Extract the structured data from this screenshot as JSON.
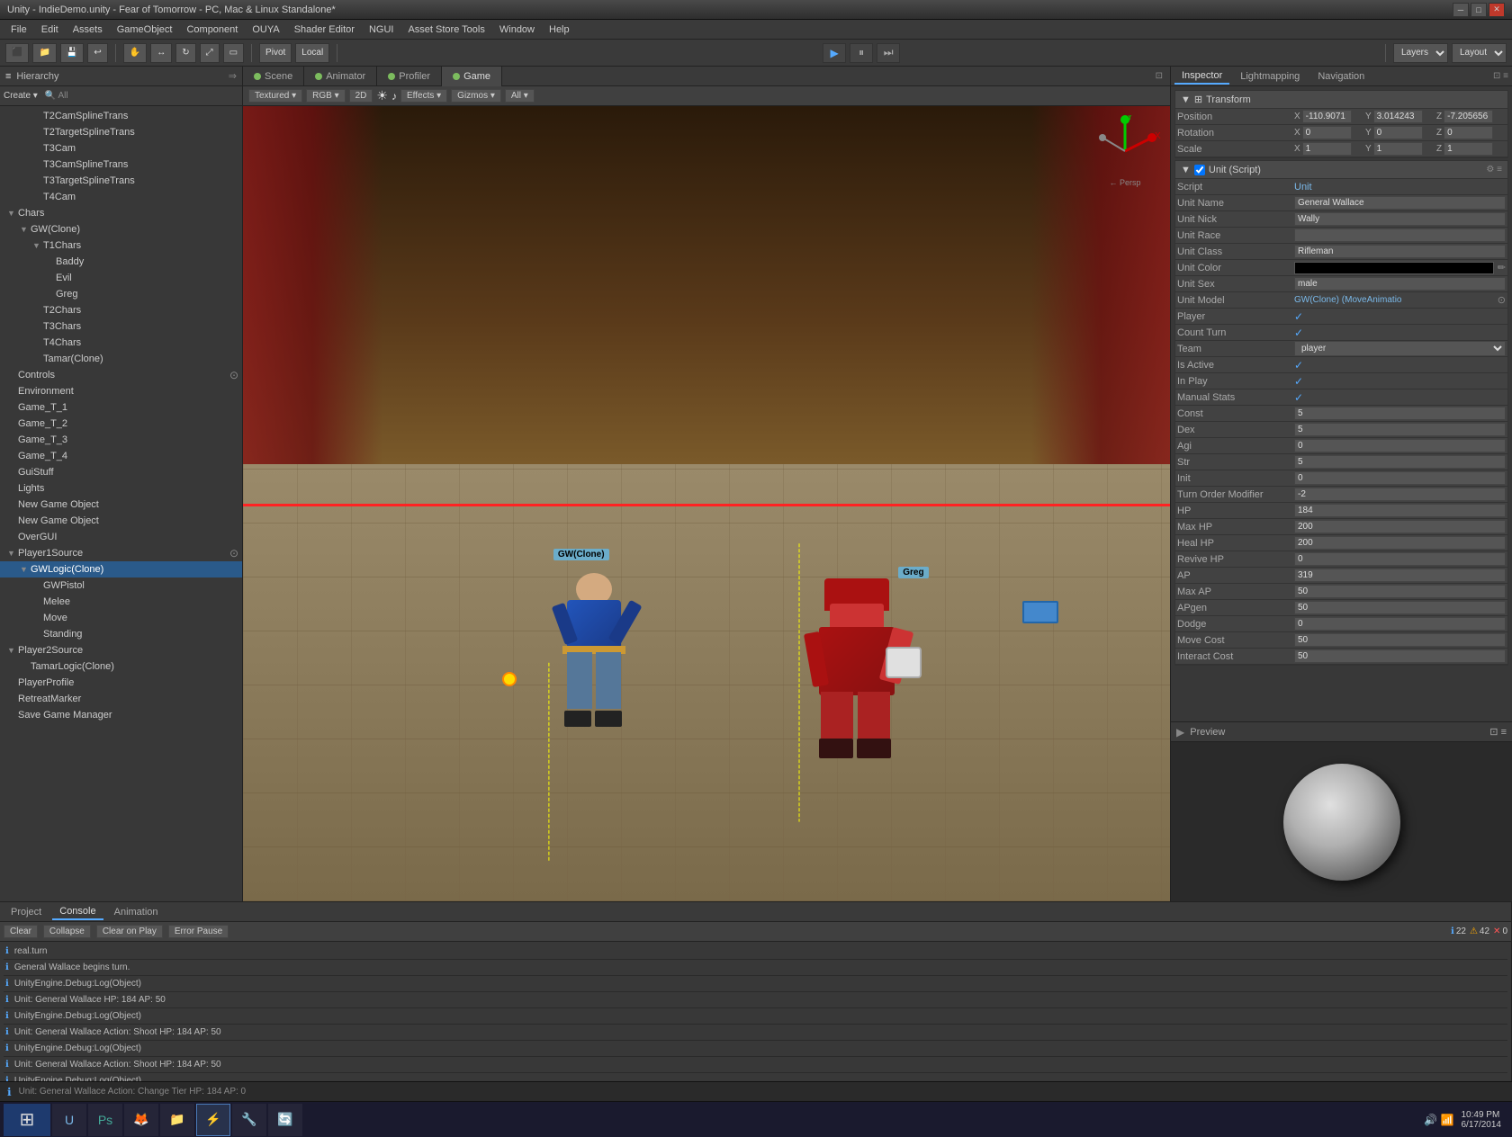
{
  "window": {
    "title": "Unity - IndieDemo.unity - Fear of Tomorrow - PC, Mac & Linux Standalone*"
  },
  "menu": {
    "items": [
      "File",
      "Edit",
      "Assets",
      "GameObject",
      "Component",
      "OUYA",
      "Shader Editor",
      "NGUI",
      "Asset Store Tools",
      "Window",
      "Help"
    ]
  },
  "toolbar": {
    "pivot_label": "Pivot",
    "local_label": "Local",
    "layers_label": "Layers",
    "layout_label": "Layout"
  },
  "tabs": {
    "scene_tabs": [
      "Scene",
      "Animator",
      "Profiler",
      "Game"
    ],
    "active_tab": "Game"
  },
  "scene_toolbar": {
    "textured": "Textured",
    "rgb": "RGB",
    "twod": "2D",
    "effects": "Effects",
    "gizmos": "Gizmos",
    "all": "All"
  },
  "hierarchy": {
    "header": "Hierarchy",
    "search_placeholder": "Create",
    "items": [
      {
        "id": "t2camsplinetrans",
        "label": "T2CamSplineTrans",
        "indent": 2,
        "arrow": false
      },
      {
        "id": "t2targetsplinetrans",
        "label": "T2TargetSplineTrans",
        "indent": 2,
        "arrow": false
      },
      {
        "id": "t3cam",
        "label": "T3Cam",
        "indent": 2,
        "arrow": false
      },
      {
        "id": "t3camsplinetrans",
        "label": "T3CamSplineTrans",
        "indent": 2,
        "arrow": false
      },
      {
        "id": "t3targetsplinetrans",
        "label": "T3TargetSplineTrans",
        "indent": 2,
        "arrow": false
      },
      {
        "id": "t4cam",
        "label": "T4Cam",
        "indent": 2,
        "arrow": false
      },
      {
        "id": "chars",
        "label": "Chars",
        "indent": 0,
        "arrow": true,
        "expanded": true
      },
      {
        "id": "gw-clone",
        "label": "GW(Clone)",
        "indent": 1,
        "arrow": true,
        "expanded": true
      },
      {
        "id": "t1chars",
        "label": "T1Chars",
        "indent": 2,
        "arrow": true,
        "expanded": true
      },
      {
        "id": "baddy",
        "label": "Baddy",
        "indent": 3,
        "arrow": false
      },
      {
        "id": "evil",
        "label": "Evil",
        "indent": 3,
        "arrow": false
      },
      {
        "id": "greg",
        "label": "Greg",
        "indent": 3,
        "arrow": false
      },
      {
        "id": "t2chars",
        "label": "T2Chars",
        "indent": 2,
        "arrow": false
      },
      {
        "id": "t3chars",
        "label": "T3Chars",
        "indent": 2,
        "arrow": false
      },
      {
        "id": "t4chars",
        "label": "T4Chars",
        "indent": 2,
        "arrow": false
      },
      {
        "id": "tamar-clone",
        "label": "Tamar(Clone)",
        "indent": 2,
        "arrow": false
      },
      {
        "id": "controls",
        "label": "Controls",
        "indent": 0,
        "arrow": false
      },
      {
        "id": "environment",
        "label": "Environment",
        "indent": 0,
        "arrow": false
      },
      {
        "id": "game-t1",
        "label": "Game_T_1",
        "indent": 0,
        "arrow": false
      },
      {
        "id": "game-t2",
        "label": "Game_T_2",
        "indent": 0,
        "arrow": false
      },
      {
        "id": "game-t3",
        "label": "Game_T_3",
        "indent": 0,
        "arrow": false
      },
      {
        "id": "game-t4",
        "label": "Game_T_4",
        "indent": 0,
        "arrow": false
      },
      {
        "id": "guistuff",
        "label": "GuiStuff",
        "indent": 0,
        "arrow": false
      },
      {
        "id": "lights",
        "label": "Lights",
        "indent": 0,
        "arrow": false
      },
      {
        "id": "new-game-obj1",
        "label": "New Game Object",
        "indent": 0,
        "arrow": false
      },
      {
        "id": "new-game-obj2",
        "label": "New Game Object",
        "indent": 0,
        "arrow": false
      },
      {
        "id": "overgui",
        "label": "OverGUI",
        "indent": 0,
        "arrow": false
      },
      {
        "id": "player1source",
        "label": "Player1Source",
        "indent": 0,
        "arrow": true,
        "expanded": true
      },
      {
        "id": "gwlogic-clone",
        "label": "GWLogic(Clone)",
        "indent": 1,
        "arrow": true,
        "expanded": true,
        "selected": true
      },
      {
        "id": "gwpistol",
        "label": "GWPistol",
        "indent": 2,
        "arrow": false
      },
      {
        "id": "melee",
        "label": "Melee",
        "indent": 2,
        "arrow": false
      },
      {
        "id": "move",
        "label": "Move",
        "indent": 2,
        "arrow": false
      },
      {
        "id": "standing",
        "label": "Standing",
        "indent": 2,
        "arrow": false
      },
      {
        "id": "player2source",
        "label": "Player2Source",
        "indent": 0,
        "arrow": true,
        "expanded": true
      },
      {
        "id": "tamarlogic-clone",
        "label": "TamarLogic(Clone)",
        "indent": 1,
        "arrow": false
      },
      {
        "id": "playerprofile",
        "label": "PlayerProfile",
        "indent": 0,
        "arrow": false
      },
      {
        "id": "retreatmarker",
        "label": "RetreatMarker",
        "indent": 0,
        "arrow": false
      },
      {
        "id": "save-game-manager",
        "label": "Save Game Manager",
        "indent": 0,
        "arrow": false
      }
    ]
  },
  "inspector": {
    "header": "Inspector",
    "lightmapping": "Lightmapping",
    "navigation": "Navigation",
    "transform": {
      "pos_x": "-110.9071",
      "pos_y": "3.014243",
      "pos_z": "-7.205656",
      "rot_x": "0",
      "rot_y": "0",
      "rot_z": "0",
      "scale_x": "1",
      "scale_y": "1",
      "scale_z": "1"
    },
    "unit_script": {
      "section_title": "Unit (Script)",
      "script_label": "Script",
      "script_value": "Unit",
      "unit_name_label": "Unit Name",
      "unit_name_value": "General Wallace",
      "unit_nick_label": "Unit Nick",
      "unit_nick_value": "Wally",
      "unit_race_label": "Unit Race",
      "unit_race_value": "",
      "unit_class_label": "Unit Class",
      "unit_class_value": "Rifleman",
      "unit_color_label": "Unit Color",
      "unit_color_value": "",
      "unit_sex_label": "Unit Sex",
      "unit_sex_value": "male",
      "unit_model_label": "Unit Model",
      "unit_model_value": "GW(Clone) (MoveAnimatio",
      "player_label": "Player",
      "player_value": true,
      "count_turn_label": "Count Turn",
      "count_turn_value": true,
      "team_label": "Team",
      "team_value": "player",
      "is_active_label": "Is Active",
      "is_active_value": true,
      "in_play_label": "In Play",
      "in_play_value": true,
      "manual_stats_label": "Manual Stats",
      "manual_stats_value": true,
      "const_label": "Const",
      "const_value": "5",
      "dex_label": "Dex",
      "dex_value": "5",
      "agi_label": "Agi",
      "agi_value": "0",
      "str_label": "Str",
      "str_value": "5",
      "init_label": "Init",
      "init_value": "0",
      "turn_order_label": "Turn Order Modifier",
      "turn_order_value": "-2",
      "hp_label": "HP",
      "hp_value": "184",
      "max_hp_label": "Max HP",
      "max_hp_value": "200",
      "heal_hp_label": "Heal HP",
      "heal_hp_value": "200",
      "revive_hp_label": "Revive HP",
      "revive_hp_value": "0",
      "ap_label": "AP",
      "ap_value": "319",
      "max_ap_label": "Max AP",
      "max_ap_value": "50",
      "apgen_label": "APgen",
      "apgen_value": "50",
      "dodge_label": "Dodge",
      "dodge_value": "0",
      "move_cost_label": "Move Cost",
      "move_cost_value": "50",
      "interact_cost_label": "Interact Cost",
      "interact_cost_value": "50"
    }
  },
  "console": {
    "tabs": [
      "Project",
      "Console",
      "Animation"
    ],
    "active_tab": "Console",
    "tools": [
      "Clear",
      "Collapse",
      "Clear on Play",
      "Error Pause"
    ],
    "counts": {
      "info": "22",
      "warn": "42",
      "error": "0"
    },
    "lines": [
      {
        "type": "info",
        "text": "real.turn"
      },
      {
        "type": "info",
        "text": "General Wallace begins turn."
      },
      {
        "type": "info",
        "text": "UnityEngine.Debug:Log(Object)"
      },
      {
        "type": "info",
        "text": "Unit: General Wallace   HP: 184   AP: 50"
      },
      {
        "type": "info",
        "text": "UnityEngine.Debug:Log(Object)"
      },
      {
        "type": "info",
        "text": "Unit: General Wallace   Action: Shoot   HP: 184   AP: 50"
      },
      {
        "type": "info",
        "text": "UnityEngine.Debug:Log(Object)"
      },
      {
        "type": "info",
        "text": "Unit: General Wallace   Action: Shoot   HP: 184   AP: 50"
      },
      {
        "type": "info",
        "text": "UnityEngine.Debug:Log(Object)"
      },
      {
        "type": "info",
        "text": "Unit: General Wallace   Action: Shoot   HP: 184   AP: 50"
      },
      {
        "type": "info",
        "text": "Unit_Engine.Debug:Log(Object)"
      }
    ]
  },
  "status_bar": {
    "text": "Unit: General Wallace  Action: Change Tier  HP: 184  AP: 0"
  },
  "taskbar": {
    "time": "10:49 PM",
    "date": "6/17/2014",
    "apps": [
      "⊞",
      "PS",
      "🦊",
      "📁",
      "⚡",
      "🔧",
      "🔄"
    ]
  },
  "preview": {
    "label": "Preview"
  },
  "game_viewport": {
    "gw_label": "GW(Clone)",
    "greg_label": "Greg"
  }
}
